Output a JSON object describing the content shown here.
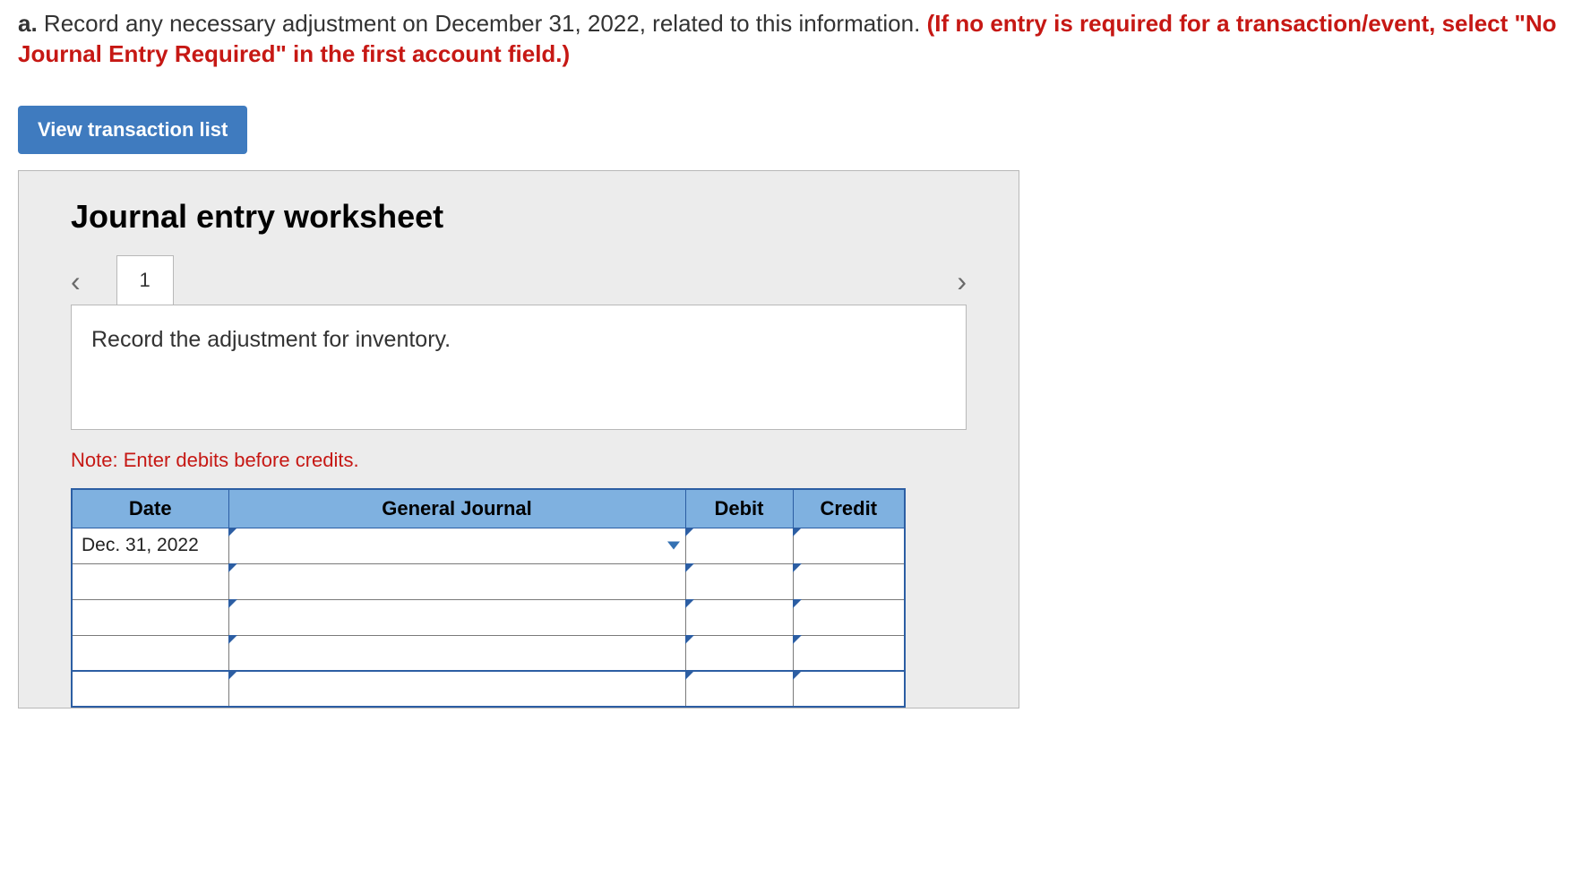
{
  "question": {
    "letter": "a.",
    "text": " Record any necessary adjustment on December 31, 2022, related to this information. ",
    "red": "(If no entry is required for a transaction/event, select \"No Journal Entry Required\" in the first account field.)"
  },
  "buttons": {
    "view_transactions": "View transaction list"
  },
  "worksheet": {
    "title": "Journal entry worksheet",
    "tab": "1",
    "description": "Record the adjustment for inventory.",
    "note": "Note: Enter debits before credits."
  },
  "table": {
    "headers": {
      "date": "Date",
      "gj": "General Journal",
      "debit": "Debit",
      "credit": "Credit"
    },
    "rows": [
      {
        "date": "Dec. 31, 2022",
        "gj": "",
        "debit": "",
        "credit": "",
        "show_dropdown": true
      },
      {
        "date": "",
        "gj": "",
        "debit": "",
        "credit": ""
      },
      {
        "date": "",
        "gj": "",
        "debit": "",
        "credit": ""
      },
      {
        "date": "",
        "gj": "",
        "debit": "",
        "credit": ""
      },
      {
        "date": "",
        "gj": "",
        "debit": "",
        "credit": ""
      }
    ]
  }
}
